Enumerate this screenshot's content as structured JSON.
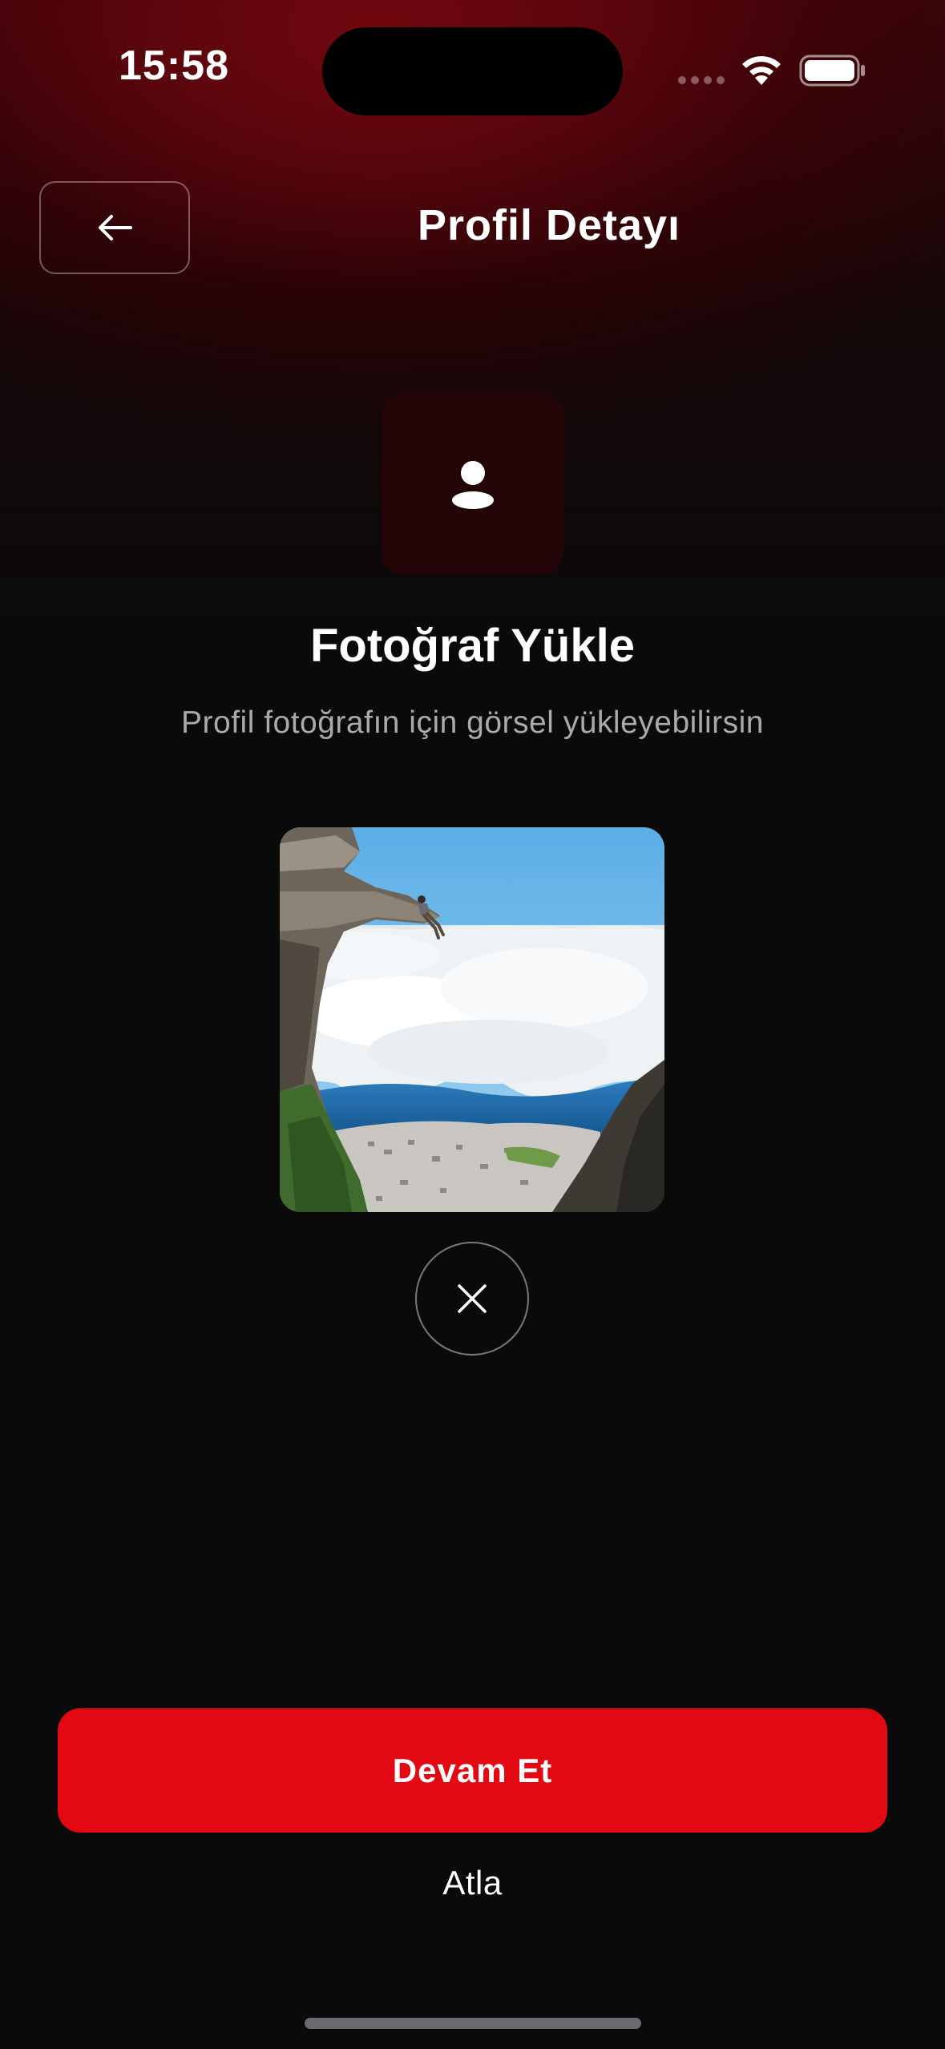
{
  "status_bar": {
    "time": "15:58",
    "icons": [
      "cellular-signal-icon",
      "wifi-icon",
      "battery-icon"
    ]
  },
  "header": {
    "back_icon": "arrow-left-icon",
    "title": "Profil Detayı"
  },
  "upload": {
    "placeholder_icon": "user-icon",
    "title": "Fotoğraf Yükle",
    "subtitle": "Profil fotoğrafın için görsel yükleyebilirsin",
    "remove_icon": "close-icon"
  },
  "actions": {
    "continue_label": "Devam Et",
    "skip_label": "Atla"
  },
  "colors": {
    "accent": "#e30913",
    "background": "#0a0a0a",
    "glow": "#9a0a14"
  }
}
